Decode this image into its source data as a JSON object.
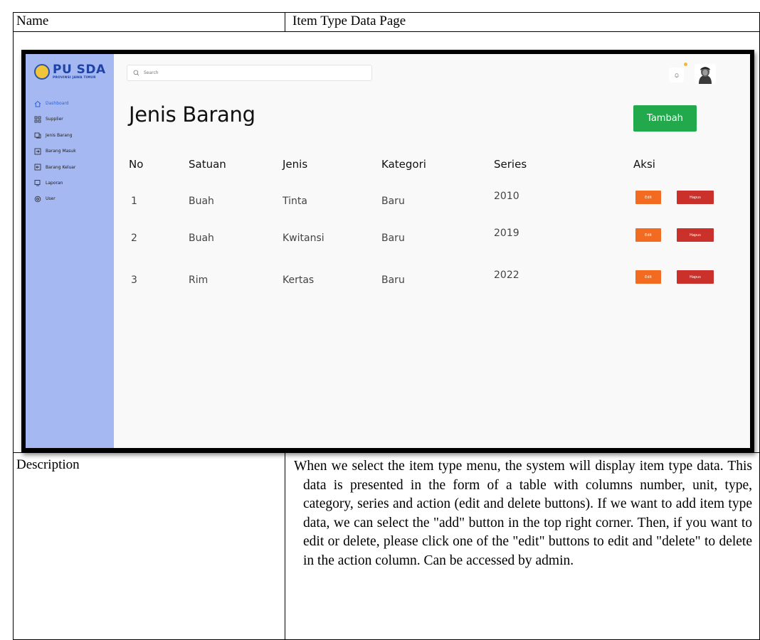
{
  "doc": {
    "name_label": "Name",
    "name_value": "Item Type Data Page",
    "description_label": "Description",
    "description_text": "When we select the item type menu, the system will display item type data. This data is presented in the form of a table with columns number, unit, type, category, series and action (edit and delete buttons). If we want to add item type data, we can select the \"add\" button in the top right corner. Then, if you want to edit or delete, please click one of the \"edit\" buttons to edit and \"delete\" to delete in the action column. Can be accessed by admin."
  },
  "app": {
    "logo": {
      "main": "PU SDA",
      "sub": "PROVINSI JAWA TIMUR"
    },
    "sidebar": {
      "items": [
        {
          "label": "Dashboard",
          "icon": "home-icon",
          "active": true
        },
        {
          "label": "Supplier",
          "icon": "supplier-icon",
          "active": false
        },
        {
          "label": "Jenis Barang",
          "icon": "item-type-icon",
          "active": false
        },
        {
          "label": "Barang Masuk",
          "icon": "item-in-icon",
          "active": false
        },
        {
          "label": "Barang Keluar",
          "icon": "item-out-icon",
          "active": false
        },
        {
          "label": "Laporan",
          "icon": "report-icon",
          "active": false
        },
        {
          "label": "User",
          "icon": "user-settings-icon",
          "active": false
        }
      ]
    },
    "search": {
      "placeholder": "Search",
      "icon": "search-icon"
    },
    "header": {
      "bell_icon": "bell-icon",
      "notification_dot_color": "#f6b63a"
    },
    "page_title": "Jenis Barang",
    "add_button": "Tambah",
    "table": {
      "headers": [
        "No",
        "Satuan",
        "Jenis",
        "Kategori",
        "Series",
        "Aksi"
      ],
      "rows": [
        {
          "no": "1",
          "satuan": "Buah",
          "jenis": "Tinta",
          "kategori": "Baru",
          "series": "2010"
        },
        {
          "no": "2",
          "satuan": "Buah",
          "jenis": "Kwitansi",
          "kategori": "Baru",
          "series": "2019"
        },
        {
          "no": "3",
          "satuan": "Rim",
          "jenis": "Kertas",
          "kategori": "Baru",
          "series": "2022"
        }
      ],
      "edit_label": "Edit",
      "delete_label": "Hapus"
    },
    "colors": {
      "sidebar": "#a5b8f2",
      "add_button": "#22a94c",
      "edit_button": "#f26b21",
      "delete_button": "#c9312a",
      "active_nav": "#2c63d8"
    }
  }
}
